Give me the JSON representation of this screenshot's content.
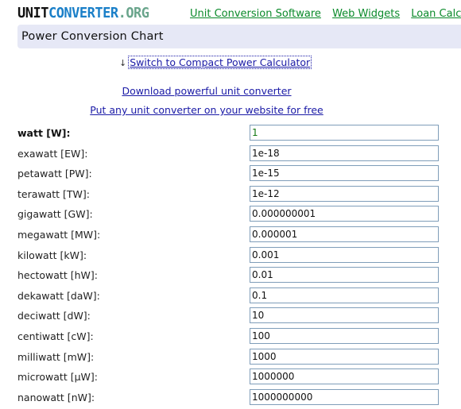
{
  "header": {
    "logo": {
      "part1": "UNIT",
      "part2": "CONVERTER",
      "part3": ".ORG"
    },
    "nav_links": [
      "Unit Conversion Software",
      "Web Widgets",
      "Loan Calcu"
    ]
  },
  "page_title": "Power Conversion Chart",
  "links": {
    "switch_arrow": "↓",
    "switch": "Switch to Compact Power Calculator",
    "download": "Download powerful unit converter",
    "widget": "Put any unit converter on your website for free"
  },
  "units": [
    {
      "label": "watt [W]:",
      "value": "1",
      "base": true
    },
    {
      "label": "exawatt [EW]:",
      "value": "1e-18"
    },
    {
      "label": "petawatt [PW]:",
      "value": "1e-15"
    },
    {
      "label": "terawatt [TW]:",
      "value": "1e-12"
    },
    {
      "label": "gigawatt [GW]:",
      "value": "0.000000001"
    },
    {
      "label": "megawatt [MW]:",
      "value": "0.000001"
    },
    {
      "label": "kilowatt [kW]:",
      "value": "0.001"
    },
    {
      "label": "hectowatt [hW]:",
      "value": "0.01"
    },
    {
      "label": "dekawatt [daW]:",
      "value": "0.1"
    },
    {
      "label": "deciwatt [dW]:",
      "value": "10"
    },
    {
      "label": "centiwatt [cW]:",
      "value": "100"
    },
    {
      "label": "milliwatt [mW]:",
      "value": "1000"
    },
    {
      "label": "microwatt [µW]:",
      "value": "1000000"
    },
    {
      "label": "nanowatt [nW]:",
      "value": "1000000000"
    }
  ],
  "colors": {
    "header_band": "#e6e8f6",
    "nav_link": "#0a8a2a",
    "body_link": "#1a1aa6",
    "input_border": "#7f9db9",
    "base_value": "#117711"
  }
}
